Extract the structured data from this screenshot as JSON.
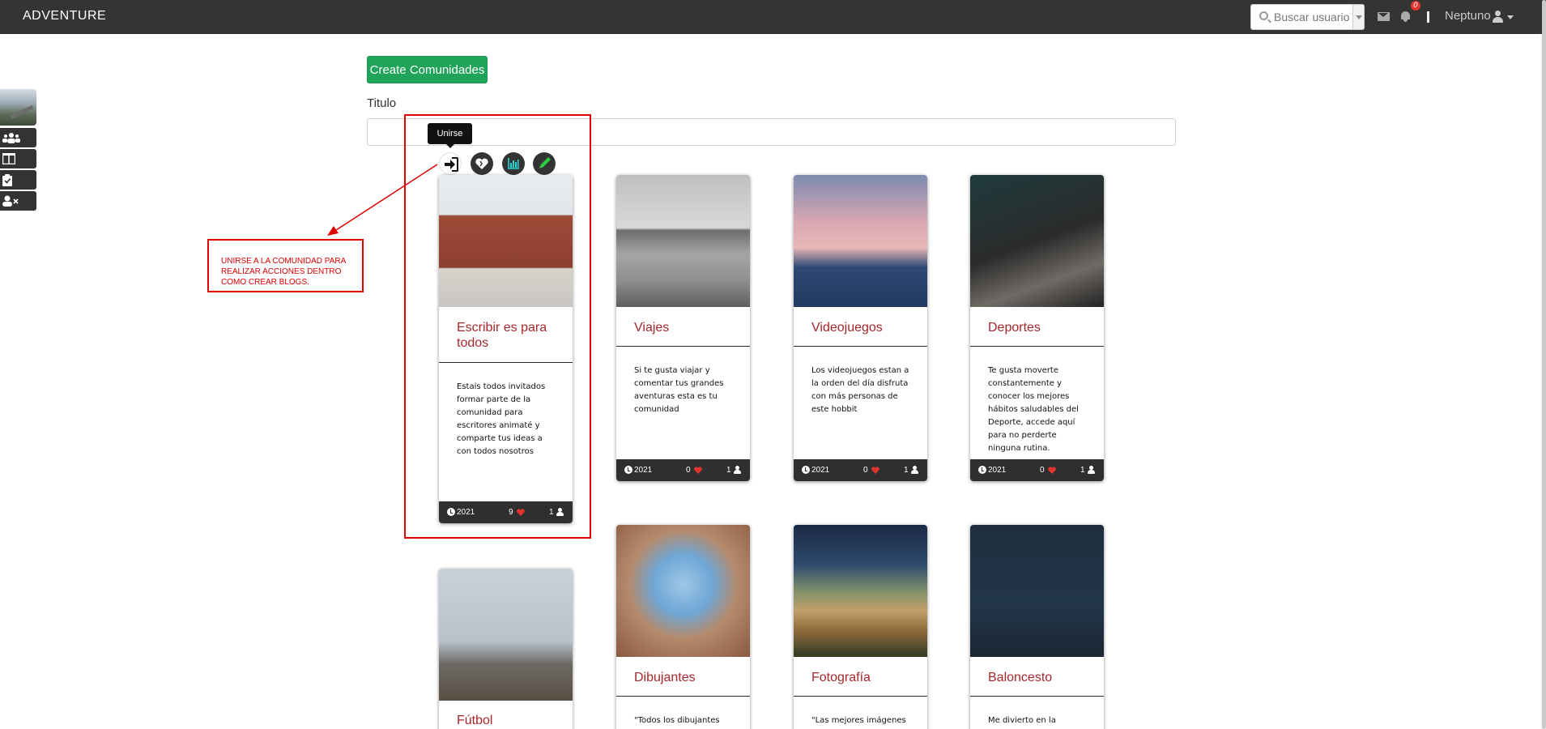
{
  "navbar": {
    "brand": "ADVENTURE",
    "search_placeholder": "Buscar usuario",
    "notification_count": "0",
    "user_name": "Neptuno"
  },
  "main": {
    "create_button": "Create Comunidades",
    "title_label": "Titulo",
    "tooltip": "Unirse"
  },
  "annotation": {
    "note": "UNIRSE A LA COMUNIDAD PARA REALIZAR ACCIONES DENTRO COMO CREAR BLOGS."
  },
  "cards": [
    {
      "title": "Escribir es para todos",
      "description": "Estais todos invitados formar parte de la comunidad para escritores animaté y comparte tus ideas a con todos nosotros",
      "year": "2021",
      "likes": "9",
      "members": "1"
    },
    {
      "title": "Viajes",
      "description": "Si te gusta viajar y comentar tus grandes aventuras esta es tu comunidad",
      "year": "2021",
      "likes": "0",
      "members": "1"
    },
    {
      "title": "Videojuegos",
      "description": "Los videojuegos estan a la orden del día disfruta con más personas de este hobbit",
      "year": "2021",
      "likes": "0",
      "members": "1"
    },
    {
      "title": "Deportes",
      "description": "Te gusta moverte constantemente y conocer los mejores hábitos saludables del Deporte, accede aquí para no perderte ninguna rutina.",
      "year": "2021",
      "likes": "0",
      "members": "1"
    },
    {
      "title": "Fútbol",
      "description": ""
    },
    {
      "title": "Dibujantes",
      "description": "\"Todos los dibujantes"
    },
    {
      "title": "Fotografía",
      "description": "\"Las mejores imágenes"
    },
    {
      "title": "Baloncesto",
      "description": "Me divierto en la cancha,"
    }
  ],
  "colors": {
    "navbar": "#343434",
    "create_button": "#1fa45a",
    "card_title": "#a8262a",
    "annotation": "#e00000"
  }
}
